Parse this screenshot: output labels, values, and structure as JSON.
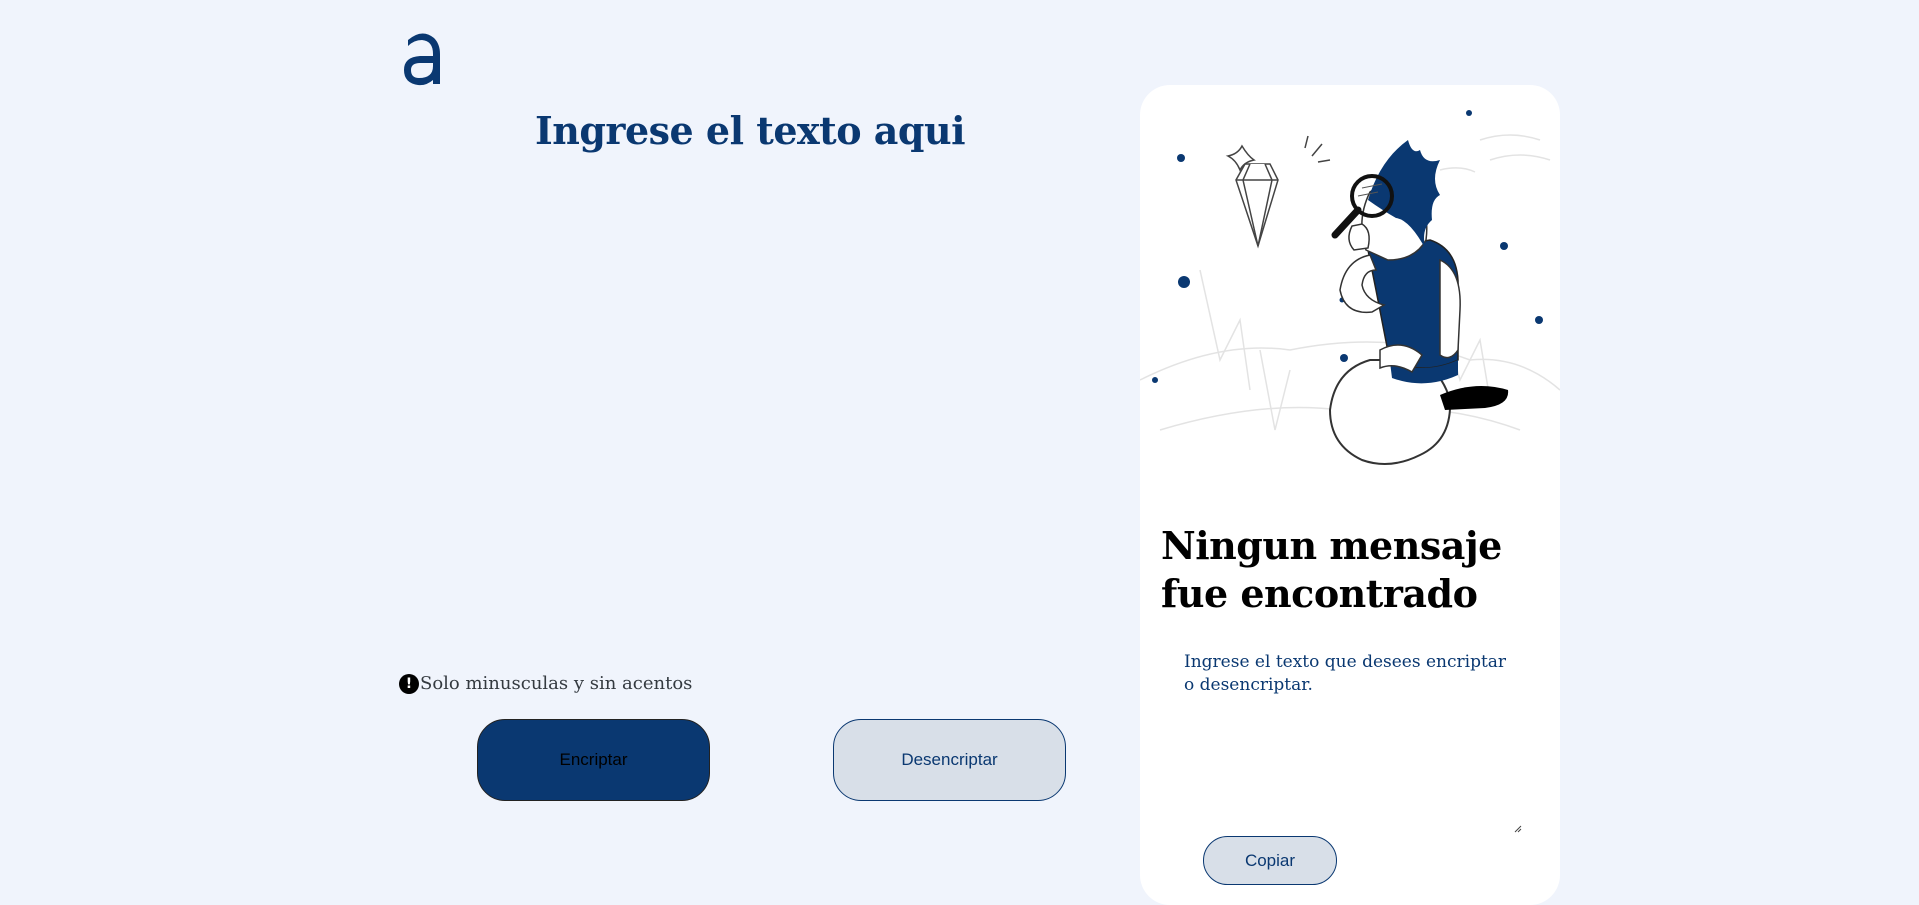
{
  "colors": {
    "brand": "#0a3871",
    "background": "#f0f4fc",
    "panel": "#ffffff",
    "secondary_button": "#d8dfe8"
  },
  "header": {
    "logo_icon": "alura-a-logo"
  },
  "main": {
    "title": "Ingrese el texto aqui",
    "input_value": "",
    "hint_icon": "exclamation-circle-icon",
    "hint": "Solo minusculas y sin acentos",
    "encrypt_label": "Encriptar",
    "decrypt_label": "Desencriptar"
  },
  "output": {
    "illustration": "person-with-magnifying-glass",
    "title": "Ningun mensaje fue encontrado",
    "text": "Ingrese el texto que desees encriptar o desencriptar.",
    "copy_label": "Copiar"
  }
}
